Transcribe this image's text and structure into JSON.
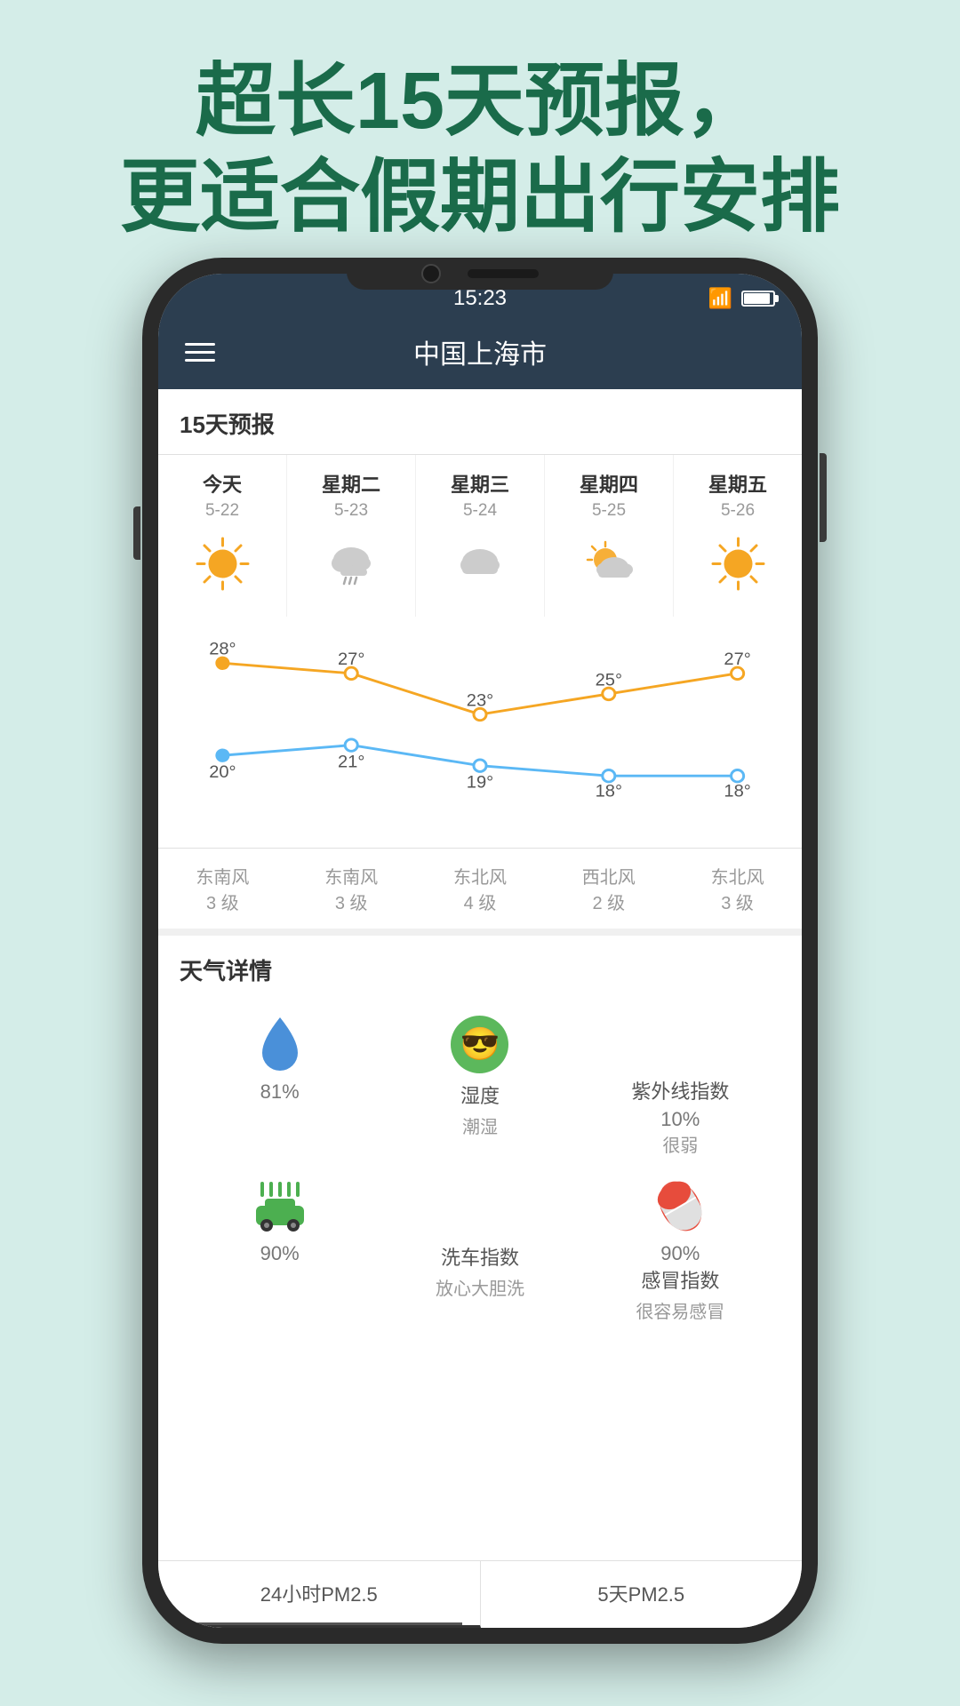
{
  "page": {
    "bg_color": "#d4ede8",
    "headline_line1": "超长15天预报，",
    "headline_line2": "更适合假期出行安排",
    "headline_color": "#1a6b4a"
  },
  "status_bar": {
    "time": "15:23",
    "wifi": "wifi",
    "battery": "battery"
  },
  "nav": {
    "title": "中国上海市",
    "menu_icon": "≡"
  },
  "forecast": {
    "section_title": "15天预报",
    "columns": [
      {
        "day": "今天",
        "date": "5-22",
        "weather": "sunny"
      },
      {
        "day": "星期二",
        "date": "5-23",
        "weather": "cloud-rain"
      },
      {
        "day": "星期三",
        "date": "5-24",
        "weather": "cloudy"
      },
      {
        "day": "星期四",
        "date": "5-25",
        "weather": "partly-cloudy"
      },
      {
        "day": "星期五",
        "date": "5-26",
        "weather": "sunny"
      }
    ],
    "high_temps": [
      28,
      27,
      23,
      25,
      27
    ],
    "low_temps": [
      20,
      21,
      19,
      18,
      18
    ],
    "winds": [
      {
        "dir": "东南风",
        "level": "3 级"
      },
      {
        "dir": "东南风",
        "level": "3 级"
      },
      {
        "dir": "东北风",
        "level": "4 级"
      },
      {
        "dir": "西北风",
        "level": "2 级"
      },
      {
        "dir": "东北风",
        "level": "3 级"
      }
    ]
  },
  "details": {
    "section_title": "天气详情",
    "items": [
      {
        "icon": "droplet",
        "value": "81%",
        "label": "",
        "sub": ""
      },
      {
        "icon": "face",
        "label": "湿度",
        "sub": "潮湿",
        "value": ""
      },
      {
        "icon": "uv",
        "label": "紫外线指数",
        "sub": "很弱",
        "value": ""
      },
      {
        "icon": "car-wash",
        "value": "90%",
        "label": "",
        "sub": ""
      },
      {
        "icon": "car-wash-label",
        "label": "洗车指数",
        "sub": "放心大胆洗",
        "value": ""
      },
      {
        "icon": "pill",
        "label": "感冒指数",
        "sub": "很容易感冒",
        "value": ""
      }
    ],
    "uv_value": "10%",
    "pill_value": "90%"
  },
  "bottom_tabs": [
    {
      "label": "24小时PM2.5",
      "active": true
    },
    {
      "label": "5天PM2.5",
      "active": false
    }
  ]
}
